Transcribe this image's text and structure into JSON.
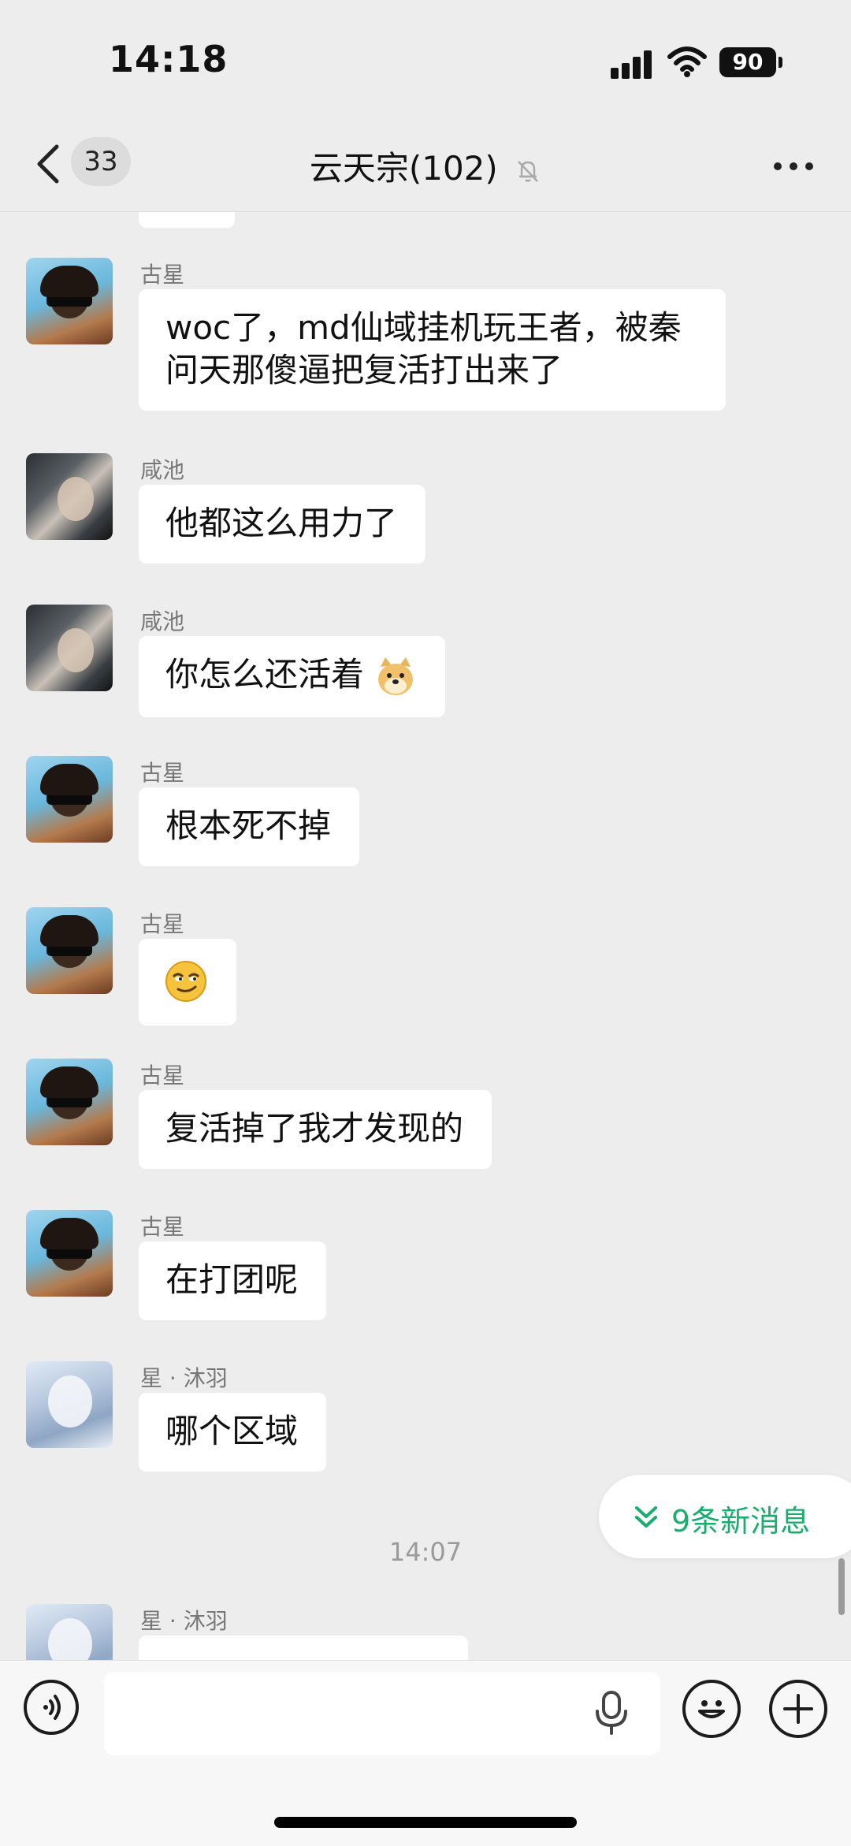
{
  "status_bar": {
    "time": "14:18",
    "battery": "90"
  },
  "header": {
    "unread_count": "33",
    "title": "云天宗(102)"
  },
  "messages": [
    {
      "sender": "古星",
      "text": "woc了，md仙域挂机玩王者，被秦问天那傻逼把复活打出来了"
    },
    {
      "sender": "咸池",
      "text": "他都这么用力了"
    },
    {
      "sender": "咸池",
      "text": "你怎么还活着"
    },
    {
      "sender": "古星",
      "text": "根本死不掉"
    },
    {
      "sender": "古星",
      "text": ""
    },
    {
      "sender": "古星",
      "text": "复活掉了我才发现的"
    },
    {
      "sender": "古星",
      "text": "在打团呢"
    },
    {
      "sender": "星 · 沐羽",
      "text": "哪个区域"
    }
  ],
  "timestamp": "14:07",
  "last_sender": "星 · 沐羽",
  "new_messages_label": "9条新消息",
  "accent_color": "#1aad6e"
}
